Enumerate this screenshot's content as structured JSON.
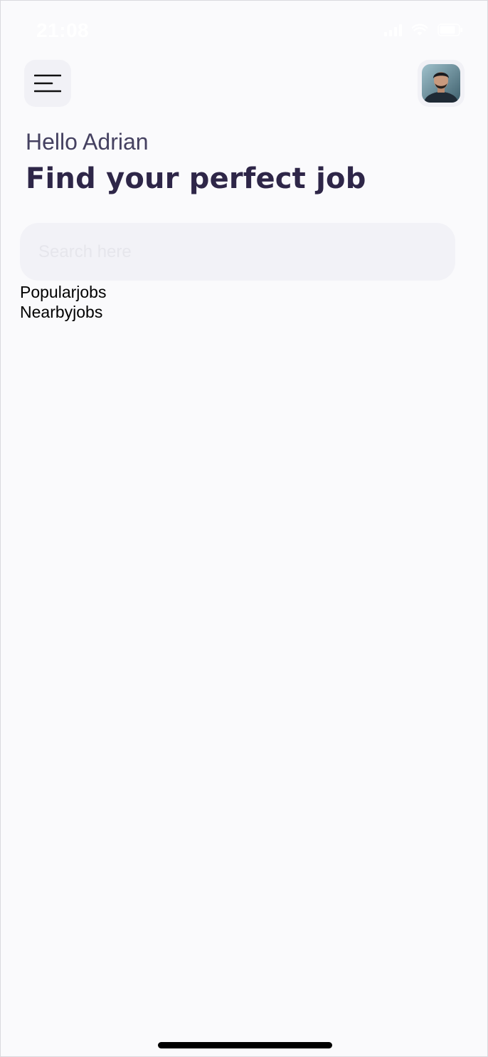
{
  "status_bar": {
    "time": "21:08"
  },
  "header": {
    "menu_icon": "menu-lines-icon",
    "avatar_icon": "profile-photo"
  },
  "greeting": {
    "hello": "Hello Adrian",
    "headline": "Find your perfect job"
  },
  "search": {
    "placeholder": "Search here",
    "value": ""
  },
  "sections": {
    "popular": "Popularjobs",
    "nearby": "Nearbyjobs"
  },
  "colors": {
    "background": "#fafafc",
    "headline": "#2e2648",
    "greeting": "#454161",
    "card_bg": "#f1f1f6"
  }
}
